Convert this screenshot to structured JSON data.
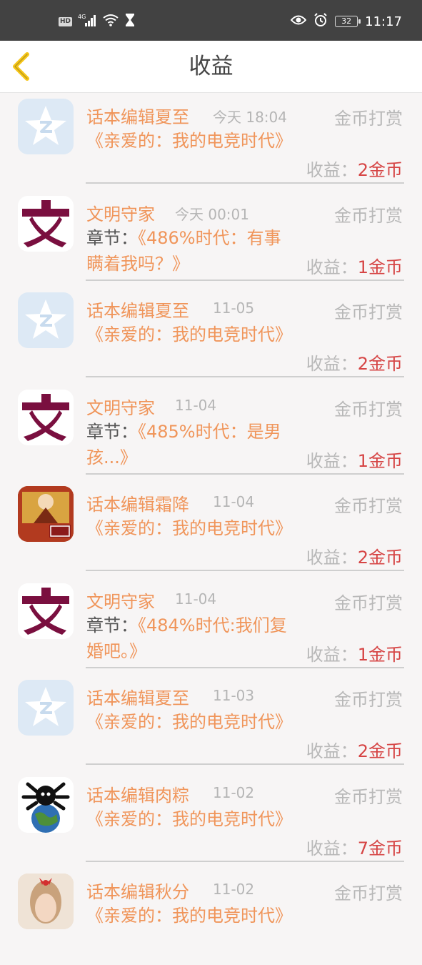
{
  "status_bar": {
    "network": "4G",
    "hd": "HD",
    "battery": "32",
    "time": "11:17"
  },
  "header": {
    "title": "收益"
  },
  "labels": {
    "income_label": "收益：",
    "chapter_prefix": "章节："
  },
  "colors": {
    "accent_orange": "#f0955a",
    "amount_red": "#d64545",
    "back_arrow": "#f5c518"
  },
  "records": [
    {
      "avatar": "qq-star-avatar",
      "name": "话本编辑夏至",
      "time": "今天 18:04",
      "type": "金币打赏",
      "prefix": "",
      "content": "《亲爱的：我的电竞时代》",
      "amount": "2金币"
    },
    {
      "avatar": "wen-character-avatar",
      "name": "文明守家",
      "time": "今天 00:01",
      "type": "金币打赏",
      "prefix": "章节：",
      "content": "《486%时代：有事瞒着我吗？》",
      "amount": "1金币"
    },
    {
      "avatar": "qq-star-avatar",
      "name": "话本编辑夏至",
      "time": "11-05",
      "type": "金币打赏",
      "prefix": "",
      "content": "《亲爱的：我的电竞时代》",
      "amount": "2金币"
    },
    {
      "avatar": "wen-character-avatar",
      "name": "文明守家",
      "time": "11-04",
      "type": "金币打赏",
      "prefix": "章节：",
      "content": "《485%时代：是男孩...》",
      "amount": "1金币"
    },
    {
      "avatar": "cartoon-red-avatar",
      "name": "话本编辑霜降",
      "time": "11-04",
      "type": "金币打赏",
      "prefix": "",
      "content": "《亲爱的：我的电竞时代》",
      "amount": "2金币"
    },
    {
      "avatar": "wen-character-avatar",
      "name": "文明守家",
      "time": "11-04",
      "type": "金币打赏",
      "prefix": "章节：",
      "content": "《484%时代:我们复婚吧。》",
      "amount": "1金币"
    },
    {
      "avatar": "qq-star-avatar",
      "name": "话本编辑夏至",
      "time": "11-03",
      "type": "金币打赏",
      "prefix": "",
      "content": "《亲爱的：我的电竞时代》",
      "amount": "2金币"
    },
    {
      "avatar": "earth-meme-avatar",
      "name": "话本编辑肉粽",
      "time": "11-02",
      "type": "金币打赏",
      "prefix": "",
      "content": "《亲爱的：我的电竞时代》",
      "amount": "7金币"
    },
    {
      "avatar": "girl-photo-avatar",
      "name": "话本编辑秋分",
      "time": "11-02",
      "type": "金币打赏",
      "prefix": "",
      "content": "《亲爱的：我的电竞时代》",
      "amount": ""
    }
  ]
}
